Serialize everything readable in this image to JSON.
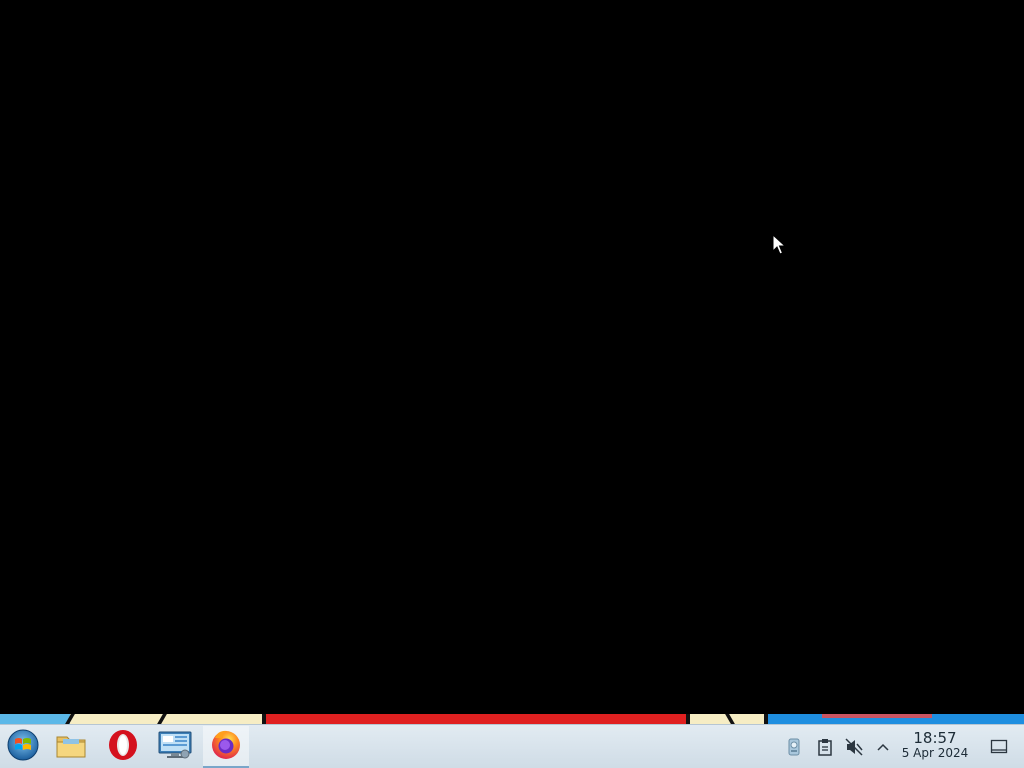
{
  "desktop": {
    "background_color": "#000000"
  },
  "taskbar": {
    "start_button": {
      "icon": "start-orb-icon"
    },
    "pinned_apps": [
      {
        "name": "File Manager",
        "icon": "folder-icon"
      },
      {
        "name": "Opera",
        "icon": "opera-icon"
      },
      {
        "name": "System Settings",
        "icon": "monitor-icon"
      },
      {
        "name": "Firefox",
        "icon": "firefox-icon",
        "active": true
      }
    ],
    "tray": {
      "icons": [
        "network-icon",
        "clipboard-icon",
        "volume-muted-icon",
        "chevron-up-icon"
      ],
      "clock": {
        "time": "18:57",
        "date": "5 Apr 2024"
      },
      "show_desktop_icon": "show-desktop-icon"
    }
  },
  "colors": {
    "taskbar_top": "#e2ebf2",
    "taskbar_bottom": "#cfdce6",
    "clock_text": "#1c2b36"
  }
}
